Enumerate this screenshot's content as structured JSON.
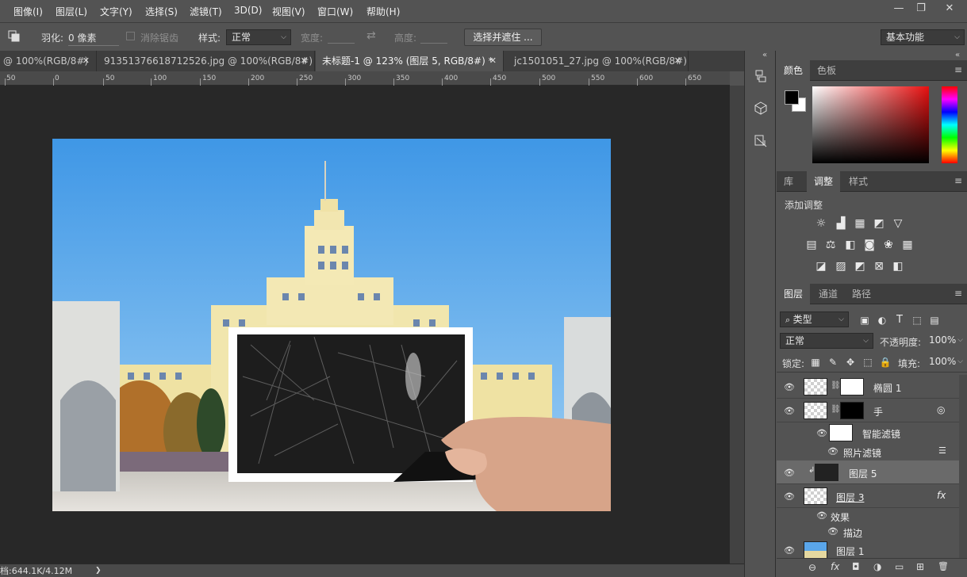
{
  "menubar": {
    "items": [
      "图像(I)",
      "图层(L)",
      "文字(Y)",
      "选择(S)",
      "滤镜(T)",
      "3D(D)",
      "视图(V)",
      "窗口(W)",
      "帮助(H)"
    ],
    "window_controls": [
      "—",
      "❐",
      "✕"
    ]
  },
  "options": {
    "feather_label": "羽化:",
    "feather_value": "0 像素",
    "antialias_label": "消除锯齿",
    "style_label": "样式:",
    "style_value": "正常",
    "width_label": "宽度:",
    "height_label": "高度:",
    "swap_icon": "⇄",
    "select_mask_button": "选择并遮住 ...",
    "workspace": "基本功能"
  },
  "tabs": [
    {
      "label": "@ 100%(RGB/8#)",
      "close": "✕"
    },
    {
      "label": "91351376618712526.jpg @ 100%(RGB/8#)",
      "close": "✕"
    },
    {
      "label": "未标题-1 @ 123% (图层 5, RGB/8#) *",
      "close": "✕"
    },
    {
      "label": "jc1501051_27.jpg @ 100%(RGB/8#)",
      "close": "✕"
    }
  ],
  "ruler": {
    "labels": [
      "50",
      "0",
      "50",
      "100",
      "150",
      "200",
      "250",
      "300",
      "350",
      "400",
      "450",
      "500",
      "550",
      "600",
      "650"
    ]
  },
  "status": {
    "text": "档:644.1K/4.12M",
    "arrow": "❯"
  },
  "dock": {
    "collapse": "«",
    "icons": [
      "history-icon",
      "3d-icon",
      "properties-icon"
    ]
  },
  "color_panel": {
    "tabs": [
      "颜色",
      "色板"
    ],
    "menu": "≡"
  },
  "adjust_panel": {
    "tabs": [
      "库",
      "调整",
      "样式"
    ],
    "title": "添加调整",
    "menu": "≡"
  },
  "layers_panel": {
    "tabs": [
      "图层",
      "通道",
      "路径"
    ],
    "menu": "≡",
    "filter_type": "类型",
    "blend_mode": "正常",
    "opacity_label": "不透明度:",
    "opacity_value": "100%",
    "lock_label": "锁定:",
    "fill_label": "填充:",
    "fill_value": "100%",
    "layers": [
      {
        "name": "椭圆 1"
      },
      {
        "name": "手"
      },
      {
        "name": "智能滤镜"
      },
      {
        "name": "照片滤镜"
      },
      {
        "name": "图层 5"
      },
      {
        "name": "图层 3",
        "fx": "fx"
      },
      {
        "name": "效果"
      },
      {
        "name": "描边"
      },
      {
        "name": "图层 1"
      }
    ],
    "bottom_icons": [
      "⊖",
      "fx",
      "◘",
      "◑",
      "▭",
      "⊞",
      "🗑"
    ]
  },
  "colors": {
    "accent": "#535353",
    "panel_dark": "#3e3e3e",
    "canvas_bg": "#282828",
    "sky": "#4aa0e8",
    "building": "#f0e4a8"
  }
}
